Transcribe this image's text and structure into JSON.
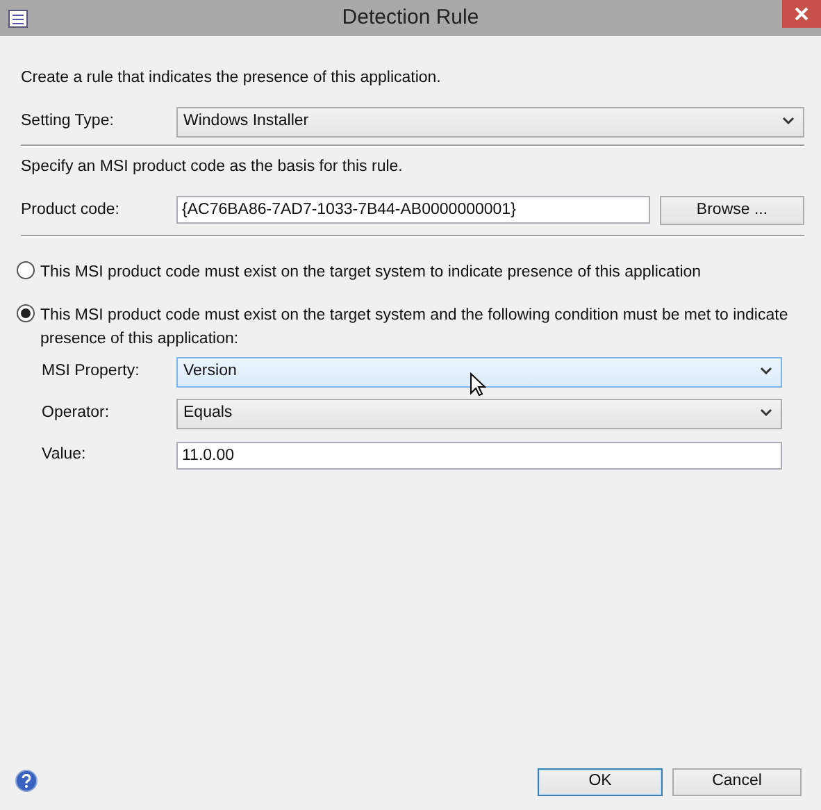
{
  "window": {
    "title": "Detection Rule"
  },
  "intro": "Create a rule that indicates the presence of this application.",
  "setting_type": {
    "label": "Setting Type:",
    "value": "Windows Installer"
  },
  "msi_hint": "Specify an MSI product code as the basis for this rule.",
  "product_code": {
    "label": "Product code:",
    "value": "{AC76BA86-7AD7-1033-7B44-AB0000000001}",
    "button": "Browse ..."
  },
  "options": [
    {
      "label": "This MSI product code must exist on the target system to indicate presence of this application",
      "selected": false
    },
    {
      "label": "This MSI product code must exist on the target system and the following condition must be met to indicate presence of this application:",
      "selected": true
    }
  ],
  "condition_fields": [
    {
      "kind": "select",
      "label": "MSI Property:",
      "value": "Version",
      "focused": true
    },
    {
      "kind": "select",
      "label": "Operator:",
      "value": "Equals",
      "focused": false
    },
    {
      "kind": "text",
      "label": "Value:",
      "value": "11.0.00",
      "focused": false
    }
  ],
  "buttons": [
    {
      "label": "OK",
      "default": true
    },
    {
      "label": "Cancel",
      "default": false
    }
  ]
}
